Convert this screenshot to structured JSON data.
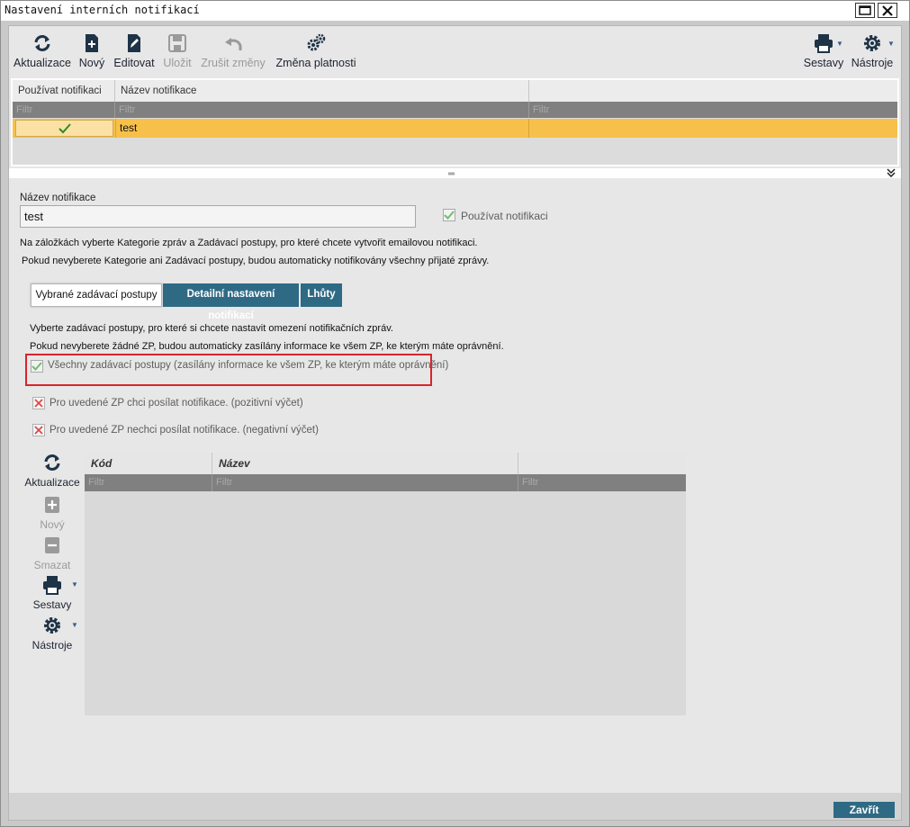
{
  "window": {
    "title": "Nastavení interních notifikací",
    "max_icon": "maximize-icon",
    "close_icon": "close-icon"
  },
  "toolbar": {
    "items": [
      {
        "label": "Aktualizace",
        "icon": "refresh-icon",
        "enabled": true
      },
      {
        "label": "Nový",
        "icon": "new-document-icon",
        "enabled": true
      },
      {
        "label": "Editovat",
        "icon": "edit-icon",
        "enabled": true
      },
      {
        "label": "Uložit",
        "icon": "save-icon",
        "enabled": false
      },
      {
        "label": "Zrušit změny",
        "icon": "undo-icon",
        "enabled": false
      },
      {
        "label": "Změna platnosti",
        "icon": "gears-icon",
        "enabled": true
      }
    ],
    "right": [
      {
        "label": "Sestavy",
        "icon": "printer-icon"
      },
      {
        "label": "Nástroje",
        "icon": "gear-icon"
      }
    ]
  },
  "top_grid": {
    "columns": [
      "Používat notifikaci",
      "Název notifikace",
      ""
    ],
    "filter_placeholder": "Filtr",
    "rows": [
      {
        "use": true,
        "name": "test"
      }
    ]
  },
  "form": {
    "name_label": "Název notifikace",
    "name_value": "test",
    "use_label": "Používat notifikaci",
    "use_checked": true,
    "info_line1": "Na záložkách vyberte Kategorie zpráv a Zadávací postupy, pro které chcete vytvořit emailovou notifikaci.",
    "info_line2": "Pokud nevyberete Kategorie ani Zadávací postupy, budou automaticky notifikovány všechny přijaté zprávy."
  },
  "tabs": [
    {
      "label": "Vybrané zadávací postupy",
      "active": true
    },
    {
      "label": "Detailní nastavení notifikací",
      "active": false
    },
    {
      "label": "Lhůty",
      "active": false
    }
  ],
  "tab_content": {
    "info_line1": "Vyberte zadávací postupy, pro které si chcete nastavit omezení notifikačních zpráv.",
    "info_line2": "Pokud nevyberete žádné ZP, budou automaticky zasílány informace ke všem ZP, ke kterým máte oprávnění.",
    "all_label": "Všechny zadávací postupy (zasílány informace ke všem ZP, ke kterým máte oprávnění)",
    "all_checked": true,
    "positive_label": "Pro uvedené ZP chci posílat notifikace. (pozitivní výčet)",
    "negative_label": "Pro uvedené ZP nechci posílat notifikace. (negativní výčet)"
  },
  "side_toolbar": [
    {
      "label": "Aktualizace",
      "icon": "refresh-icon",
      "enabled": true
    },
    {
      "label": "Nový",
      "icon": "plus-icon",
      "enabled": false
    },
    {
      "label": "Smazat",
      "icon": "minus-icon",
      "enabled": false
    },
    {
      "label": "Sestavy",
      "icon": "printer-icon",
      "enabled": true
    },
    {
      "label": "Nástroje",
      "icon": "gear-icon",
      "enabled": true
    }
  ],
  "bottom_grid": {
    "columns": [
      "Kód",
      "Název",
      ""
    ],
    "filter_placeholder": "Filtr"
  },
  "footer": {
    "close_label": "Zavřít"
  },
  "colors": {
    "accent": "#2f6a85",
    "selected_row": "#f6c04a",
    "highlight_border": "#d9242b"
  }
}
